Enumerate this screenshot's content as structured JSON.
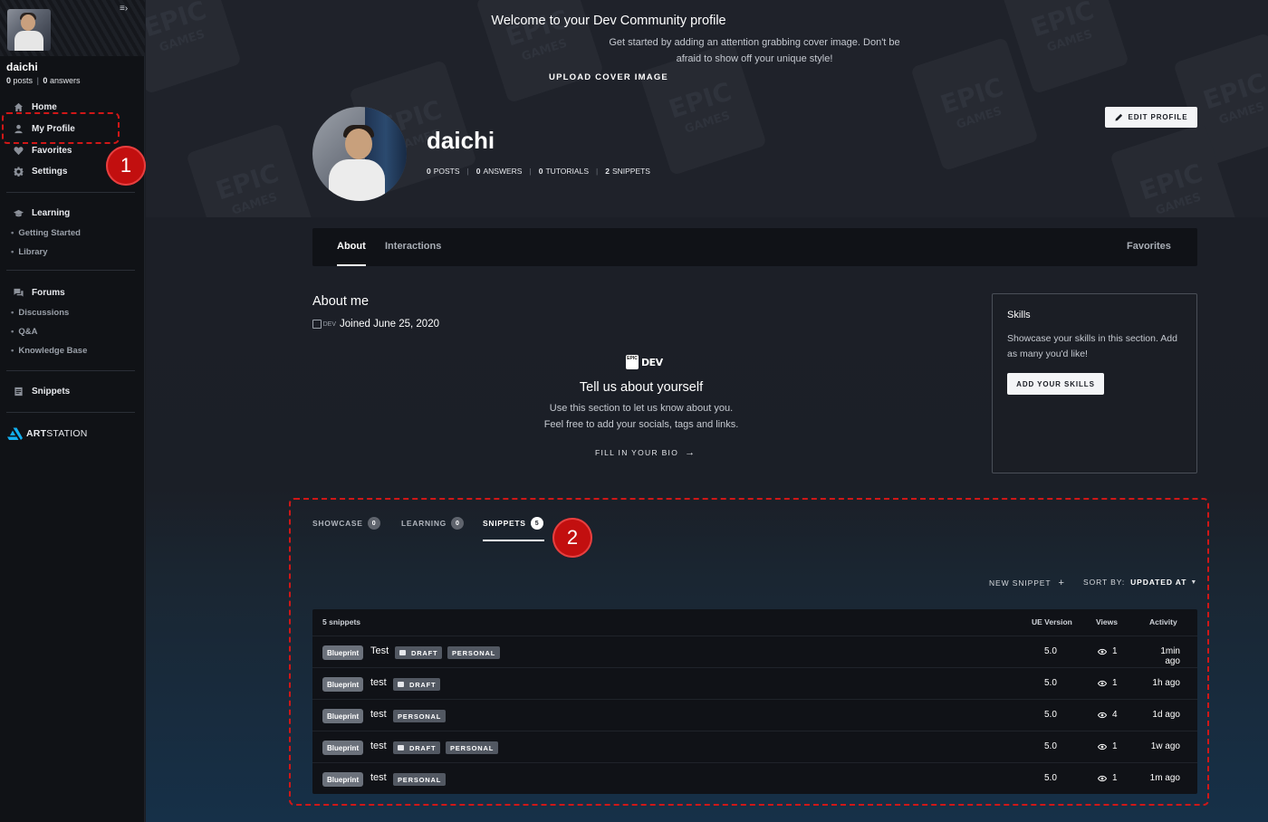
{
  "sidebar": {
    "collapse_icon": "collapse-icon",
    "user_name": "daichi",
    "posts_count": "0",
    "posts_label": "posts",
    "answers_count": "0",
    "answers_label": "answers",
    "nav_main": [
      {
        "label": "Home",
        "icon": "home-icon"
      },
      {
        "label": "My Profile",
        "icon": "user-icon"
      },
      {
        "label": "Favorites",
        "icon": "heart-icon"
      },
      {
        "label": "Settings",
        "icon": "gear-icon"
      }
    ],
    "learning": {
      "label": "Learning",
      "items": [
        "Getting Started",
        "Library"
      ]
    },
    "forums": {
      "label": "Forums",
      "items": [
        "Discussions",
        "Q&A",
        "Knowledge Base"
      ]
    },
    "snippets": {
      "label": "Snippets"
    },
    "artstation": {
      "bold": "ART",
      "rest": "STATION"
    }
  },
  "cover": {
    "title": "Welcome to your Dev Community profile",
    "subtitle": "Get started by adding an attention grabbing cover image. Don't be afraid to show off your unique style!",
    "upload_label": "UPLOAD COVER IMAGE",
    "watermark_l1": "EPIC",
    "watermark_l2": "GAMES"
  },
  "profile": {
    "name": "daichi",
    "edit_label": "EDIT PROFILE",
    "stats": [
      {
        "value": "0",
        "label": "POSTS"
      },
      {
        "value": "0",
        "label": "ANSWERS"
      },
      {
        "value": "0",
        "label": "TUTORIALS"
      },
      {
        "value": "2",
        "label": "SNIPPETS"
      }
    ]
  },
  "tabs": {
    "about": "About",
    "interactions": "Interactions",
    "favorites": "Favorites"
  },
  "about": {
    "title": "About me",
    "dev_badge": "DEV",
    "joined": "Joined June 25, 2020",
    "logo_box": "EPIC",
    "logo_text": "DEV",
    "tell_title": "Tell us about yourself",
    "tell_sub_1": "Use this section to let us know about you.",
    "tell_sub_2": "Feel free to add your socials, tags and links.",
    "fill_bio": "FILL IN YOUR BIO",
    "arrow": "→"
  },
  "skills": {
    "title": "Skills",
    "subtitle": "Showcase your skills in this section. Add as many you'd like!",
    "button": "ADD YOUR SKILLS"
  },
  "content_tabs": [
    {
      "label": "SHOWCASE",
      "count": "0"
    },
    {
      "label": "LEARNING",
      "count": "0"
    },
    {
      "label": "SNIPPETS",
      "count": "5"
    }
  ],
  "actions": {
    "new_snippet": "NEW SNIPPET",
    "plus": "+",
    "sort_by": "SORT BY:",
    "sort_value": "UPDATED AT",
    "caret": "▼"
  },
  "table": {
    "count_label": "5 snippets",
    "col_ue": "UE Version",
    "col_views": "Views",
    "col_activity": "Activity",
    "rows": [
      {
        "type": "Blueprint",
        "title": "Test",
        "draft": "DRAFT",
        "personal": "PERSONAL",
        "ue": "5.0",
        "views": "1",
        "activity": "1min ago"
      },
      {
        "type": "Blueprint",
        "title": "test",
        "draft": "DRAFT",
        "personal": "",
        "ue": "5.0",
        "views": "1",
        "activity": "1h ago"
      },
      {
        "type": "Blueprint",
        "title": "test",
        "draft": "",
        "personal": "PERSONAL",
        "ue": "5.0",
        "views": "4",
        "activity": "1d ago"
      },
      {
        "type": "Blueprint",
        "title": "test",
        "draft": "DRAFT",
        "personal": "PERSONAL",
        "ue": "5.0",
        "views": "1",
        "activity": "1w ago"
      },
      {
        "type": "Blueprint",
        "title": "test",
        "draft": "",
        "personal": "PERSONAL",
        "ue": "5.0",
        "views": "1",
        "activity": "1m ago"
      }
    ]
  },
  "annotations": {
    "n1": "1",
    "n2": "2"
  },
  "colors": {
    "annotation": "#d01717",
    "tab_bar": "#101217",
    "sidebar": "#101216"
  }
}
